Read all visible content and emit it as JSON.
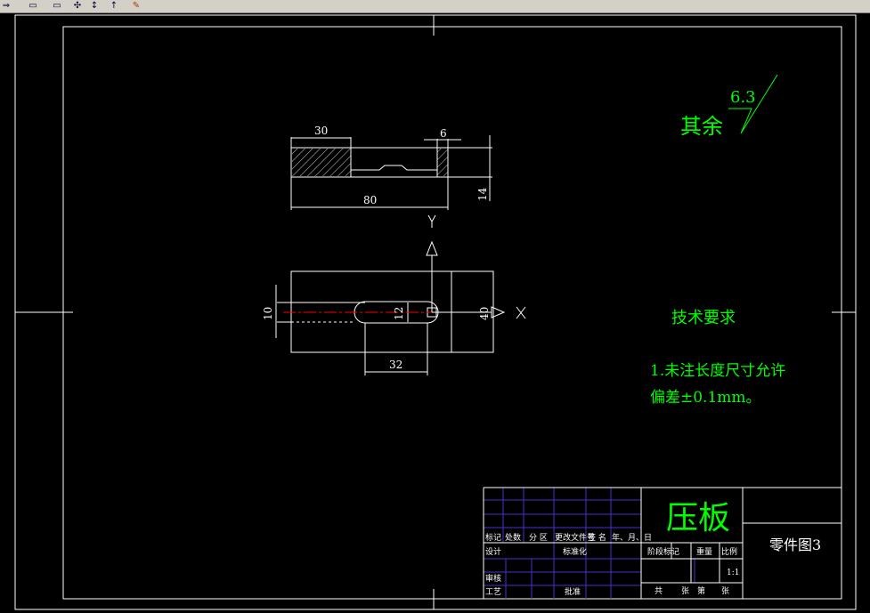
{
  "toolbar": {
    "icons": [
      "redo-icon",
      "copy-icon",
      "paste-icon",
      "match-properties-icon",
      "pan-icon",
      "cursor-icon",
      "brush-icon"
    ]
  },
  "colors": {
    "background": "#000000",
    "geometry": "#ffffff",
    "centerline": "#ff0000",
    "annotation": "#00ff00",
    "titleblock_grid": "#4a30c8"
  },
  "drawing": {
    "roughness": {
      "prefix": "其余",
      "value": "6.3"
    },
    "top_view": {
      "dims": {
        "d30": "30",
        "d6": "6",
        "d80": "80",
        "d14": "14"
      }
    },
    "front_view": {
      "dims": {
        "d10": "10",
        "d12": "12",
        "d40": "40",
        "d32": "32"
      },
      "axis_x": "X",
      "axis_y": "Y"
    },
    "notes": {
      "title": "技术要求",
      "line1": "1.未注长度尺寸允许",
      "line2": "偏差±0.1mm。"
    }
  },
  "title_block": {
    "part_name": "压板",
    "drawing_no": "零件图3",
    "header_cols": [
      "标记",
      "处数",
      "分 区",
      "更改文件号",
      "签 名",
      "年、月、日"
    ],
    "design": "设计",
    "standardize": "标准化",
    "review": "审核",
    "process": "工艺",
    "approve": "批准",
    "stage_mark": "阶段标记",
    "weight": "重量",
    "scale_label": "比例",
    "scale_value": "1:1",
    "sheets": [
      "共",
      "张",
      "第",
      "张"
    ]
  }
}
